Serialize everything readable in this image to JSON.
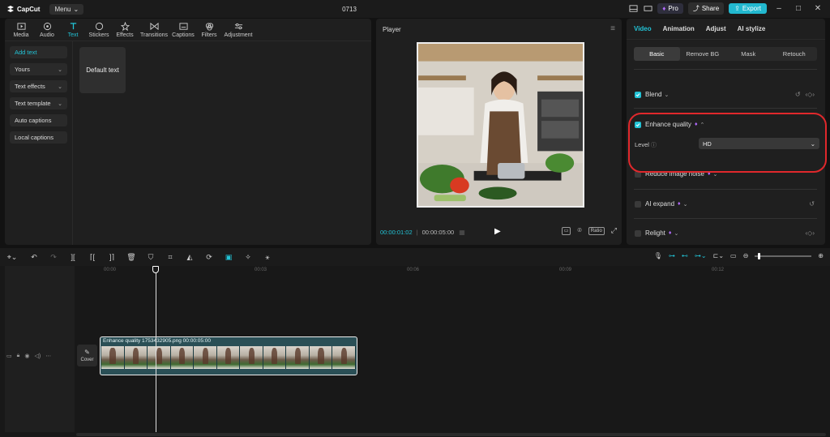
{
  "app": {
    "name": "CapCut",
    "menu_label": "Menu",
    "project_title": "0713",
    "pro_label": "Pro",
    "share_label": "Share",
    "export_label": "Export"
  },
  "media_toolbar": {
    "items": [
      "Media",
      "Audio",
      "Text",
      "Stickers",
      "Effects",
      "Transitions",
      "Captions",
      "Filters",
      "Adjustment"
    ]
  },
  "text_sidebar": {
    "items": [
      {
        "label": "Add text",
        "has_dropdown": false
      },
      {
        "label": "Yours",
        "has_dropdown": true
      },
      {
        "label": "Text effects",
        "has_dropdown": true
      },
      {
        "label": "Text template",
        "has_dropdown": true
      },
      {
        "label": "Auto captions",
        "has_dropdown": false
      },
      {
        "label": "Local captions",
        "has_dropdown": false
      }
    ],
    "default_text_card": "Default text"
  },
  "player": {
    "title": "Player",
    "current_time": "00:00:01:02",
    "total_time": "00:00:05:00",
    "ratio_label": "Ratio"
  },
  "right_panel": {
    "tabs": [
      "Video",
      "Animation",
      "Adjust",
      "AI stylize"
    ],
    "subtabs": [
      "Basic",
      "Remove BG",
      "Mask",
      "Retouch"
    ],
    "blend_label": "Blend",
    "enhance_label": "Enhance quality",
    "level_label": "Level",
    "level_value": "HD",
    "noise_label": "Reduce image noise",
    "expand_label": "AI expand",
    "relight_label": "Relight"
  },
  "timeline": {
    "ticks": [
      "00:00",
      "00:03",
      "00:06",
      "00:09",
      "00:12"
    ],
    "clip_label": "Enhance quality  1753432905.png  00:00:05:00",
    "cover_label": "Cover"
  },
  "colors": {
    "accent": "#22c3d6",
    "highlight_ring": "#e0282c",
    "background": "#121212",
    "panel": "#1f1f1f"
  }
}
